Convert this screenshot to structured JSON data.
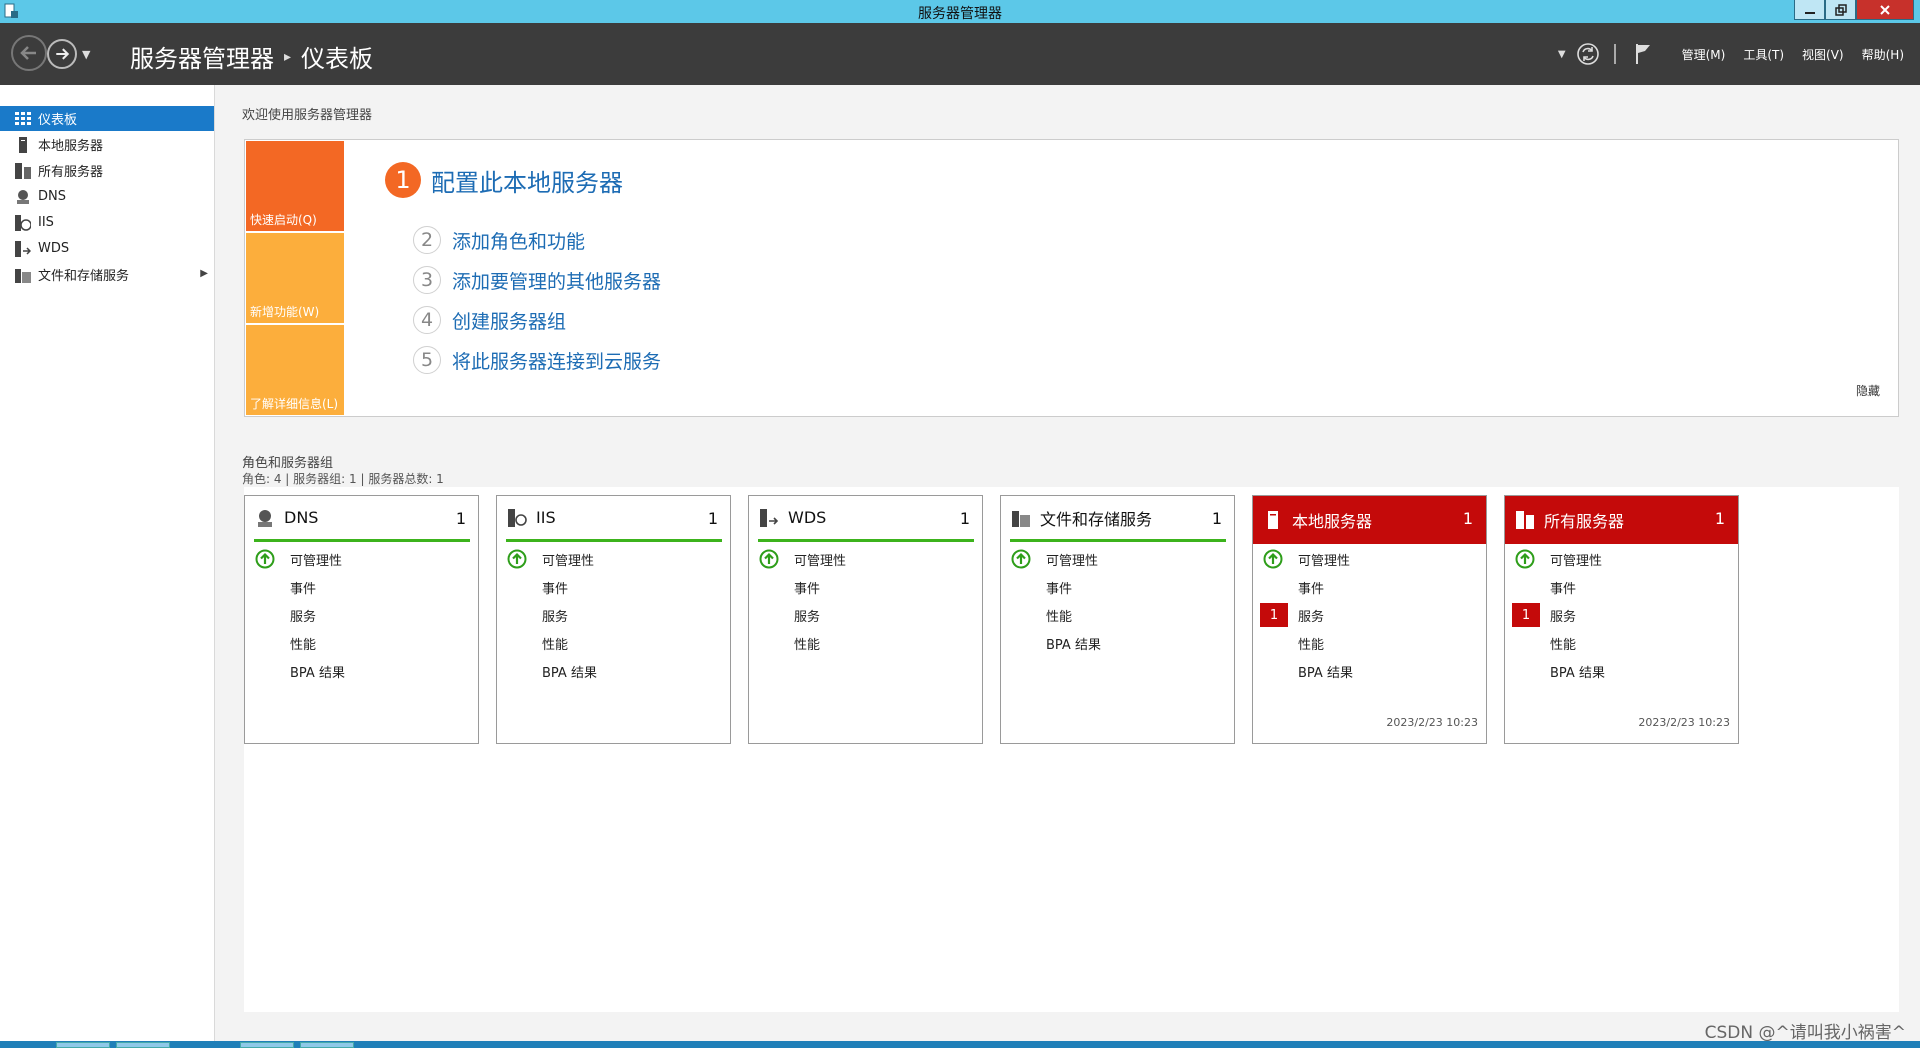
{
  "window": {
    "title": "服务器管理器"
  },
  "header": {
    "breadcrumb": [
      "服务器管理器",
      "仪表板"
    ],
    "menus": [
      "管理(M)",
      "工具(T)",
      "视图(V)",
      "帮助(H)"
    ]
  },
  "sidebar": {
    "items": [
      {
        "label": "仪表板",
        "icon": "dashboard-icon",
        "selected": true
      },
      {
        "label": "本地服务器",
        "icon": "server-icon"
      },
      {
        "label": "所有服务器",
        "icon": "servers-icon"
      },
      {
        "label": "DNS",
        "icon": "dns-icon"
      },
      {
        "label": "IIS",
        "icon": "iis-icon"
      },
      {
        "label": "WDS",
        "icon": "wds-icon"
      },
      {
        "label": "文件和存储服务",
        "icon": "file-storage-icon",
        "expandable": true
      }
    ]
  },
  "welcome": {
    "title": "欢迎使用服务器管理器",
    "tiles": [
      "快速启动(Q)",
      "新增功能(W)",
      "了解详细信息(L)"
    ],
    "step1": {
      "num": "1",
      "label": "配置此本地服务器"
    },
    "steps": [
      {
        "num": "2",
        "label": "添加角色和功能"
      },
      {
        "num": "3",
        "label": "添加要管理的其他服务器"
      },
      {
        "num": "4",
        "label": "创建服务器组"
      },
      {
        "num": "5",
        "label": "将此服务器连接到云服务"
      }
    ],
    "hide": "隐藏"
  },
  "roles": {
    "title": "角色和服务器组",
    "subtitle": "角色: 4 | 服务器组: 1 | 服务器总数: 1",
    "tiles": [
      {
        "title": "DNS",
        "count": "1",
        "red": false,
        "icon": "dns-icon",
        "rows": [
          {
            "label": "可管理性",
            "mark": "ok"
          },
          {
            "label": "事件"
          },
          {
            "label": "服务"
          },
          {
            "label": "性能"
          },
          {
            "label": "BPA 结果"
          }
        ],
        "timestamp": ""
      },
      {
        "title": "IIS",
        "count": "1",
        "red": false,
        "icon": "iis-icon",
        "rows": [
          {
            "label": "可管理性",
            "mark": "ok"
          },
          {
            "label": "事件"
          },
          {
            "label": "服务"
          },
          {
            "label": "性能"
          },
          {
            "label": "BPA 结果"
          }
        ],
        "timestamp": ""
      },
      {
        "title": "WDS",
        "count": "1",
        "red": false,
        "icon": "wds-icon",
        "rows": [
          {
            "label": "可管理性",
            "mark": "ok"
          },
          {
            "label": "事件"
          },
          {
            "label": "服务"
          },
          {
            "label": "性能"
          }
        ],
        "timestamp": ""
      },
      {
        "title": "文件和存储服务",
        "count": "1",
        "red": false,
        "icon": "file-storage-icon",
        "rows": [
          {
            "label": "可管理性",
            "mark": "ok"
          },
          {
            "label": "事件"
          },
          {
            "label": "性能"
          },
          {
            "label": "BPA 结果"
          }
        ],
        "timestamp": ""
      },
      {
        "title": "本地服务器",
        "count": "1",
        "red": true,
        "icon": "server-icon",
        "rows": [
          {
            "label": "可管理性",
            "mark": "ok"
          },
          {
            "label": "事件"
          },
          {
            "label": "服务",
            "badge": "1"
          },
          {
            "label": "性能"
          },
          {
            "label": "BPA 结果"
          }
        ],
        "timestamp": "2023/2/23 10:23"
      },
      {
        "title": "所有服务器",
        "count": "1",
        "red": true,
        "icon": "servers-icon",
        "rows": [
          {
            "label": "可管理性",
            "mark": "ok"
          },
          {
            "label": "事件"
          },
          {
            "label": "服务",
            "badge": "1"
          },
          {
            "label": "性能"
          },
          {
            "label": "BPA 结果"
          }
        ],
        "timestamp": "2023/2/23 10:23"
      }
    ]
  },
  "watermark": "CSDN @^请叫我小祸害^",
  "colors": {
    "accent": "#1a7ac9",
    "orange": "#f36824",
    "amber": "#fcae3c",
    "red": "#c40a0a",
    "green": "#3cb31c",
    "link": "#1d6cb4"
  }
}
